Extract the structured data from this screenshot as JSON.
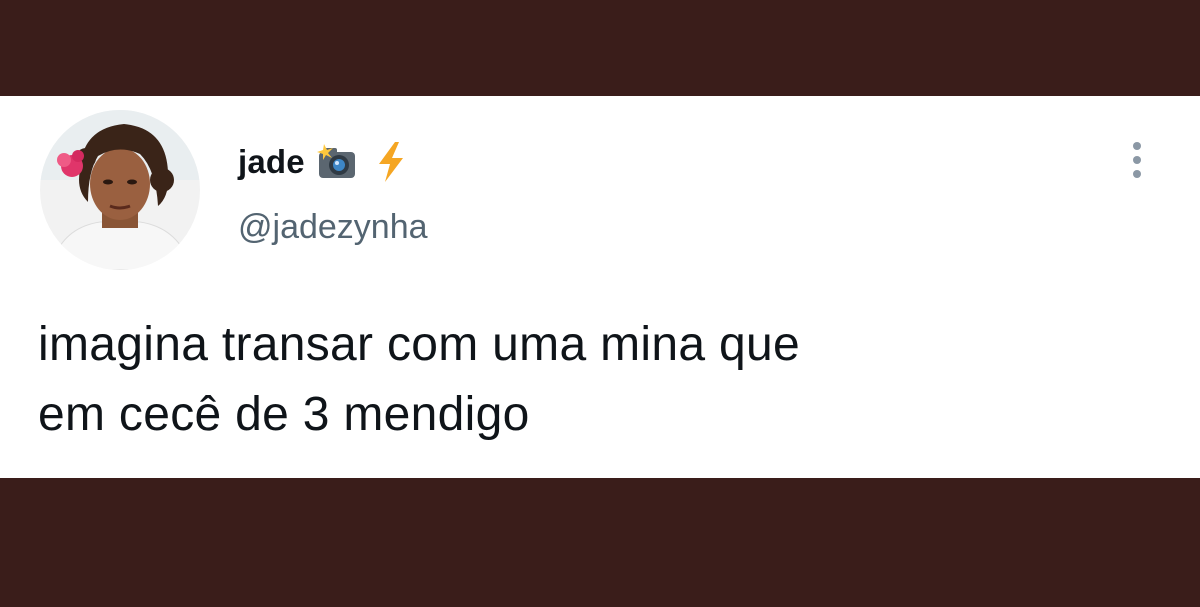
{
  "tweet": {
    "author": {
      "display_name": "jade",
      "handle": "@jadezynha",
      "name_emojis": [
        "camera-flash-icon",
        "lightning-bolt-icon"
      ],
      "avatar": "profile-photo"
    },
    "text_lines": [
      "imagina transar com uma mina que",
      "em cecê de 3 mendigo"
    ],
    "more_icon": "more-vertical-icon"
  },
  "colors": {
    "frame_background": "#3a1d1a",
    "card_background": "#ffffff",
    "text_primary": "#0f1419",
    "text_secondary": "#536471",
    "bolt": "#f5a623"
  }
}
